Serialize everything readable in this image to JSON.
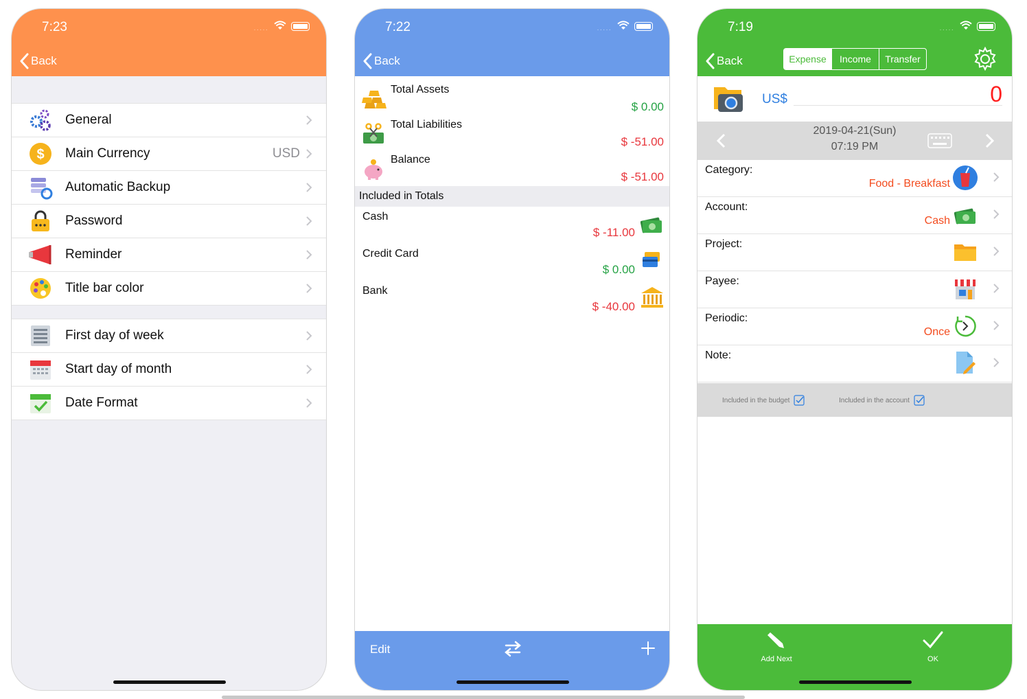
{
  "phone1": {
    "time": "7:23",
    "back": "Back",
    "section1": [
      {
        "label": "General",
        "value": "",
        "icon": "gears-icon"
      },
      {
        "label": "Main Currency",
        "value": "USD",
        "icon": "dollar-coin-icon"
      },
      {
        "label": "Automatic Backup",
        "value": "",
        "icon": "backup-icon"
      },
      {
        "label": "Password",
        "value": "",
        "icon": "lock-icon"
      },
      {
        "label": "Reminder",
        "value": "",
        "icon": "megaphone-icon"
      },
      {
        "label": "Title bar color",
        "value": "",
        "icon": "palette-icon"
      }
    ],
    "section2": [
      {
        "label": "First day of week",
        "icon": "list-icon"
      },
      {
        "label": "Start day of month",
        "icon": "calendar-icon"
      },
      {
        "label": "Date Format",
        "icon": "calendar-check-icon"
      }
    ],
    "accent": "#fe914d"
  },
  "phone2": {
    "time": "7:22",
    "back": "Back",
    "summary": [
      {
        "label": "Total Assets",
        "value": "$ 0.00",
        "status": "positive",
        "icon": "gold-bars-icon"
      },
      {
        "label": "Total Liabilities",
        "value": "$ -51.00",
        "status": "negative",
        "icon": "cash-scissors-icon"
      },
      {
        "label": "Balance",
        "value": "$ -51.00",
        "status": "negative",
        "icon": "piggy-bank-icon"
      }
    ],
    "section_header": "Included in Totals",
    "accounts": [
      {
        "label": "Cash",
        "value": "$ -11.00",
        "status": "negative",
        "icon": "cash-icon"
      },
      {
        "label": "Credit Card",
        "value": "$ 0.00",
        "status": "positive",
        "icon": "credit-card-icon"
      },
      {
        "label": "Bank",
        "value": "$ -40.00",
        "status": "negative",
        "icon": "bank-icon"
      }
    ],
    "toolbar": {
      "edit": "Edit"
    },
    "accent": "#6a9bea"
  },
  "phone3": {
    "time": "7:19",
    "back": "Back",
    "segments": [
      "Expense",
      "Income",
      "Transfer"
    ],
    "active_segment": "Expense",
    "currency": "US$",
    "amount": "0",
    "date": "2019-04-21(Sun)",
    "time_of_entry": "07:19 PM",
    "fields": [
      {
        "label": "Category:",
        "value": "Food - Breakfast",
        "icon": "drink-icon"
      },
      {
        "label": "Account:",
        "value": "Cash",
        "icon": "cash-icon"
      },
      {
        "label": "Project:",
        "value": "",
        "icon": "folder-icon"
      },
      {
        "label": "Payee:",
        "value": "",
        "icon": "store-icon"
      },
      {
        "label": "Periodic:",
        "value": "Once",
        "icon": "repeat-icon"
      },
      {
        "label": "Note:",
        "value": "",
        "icon": "note-icon"
      }
    ],
    "checks": {
      "budget": "Included in the budget",
      "account": "Included in the account"
    },
    "bottom": {
      "add_next": "Add Next",
      "ok": "OK"
    },
    "accent": "#4bbb3a"
  }
}
